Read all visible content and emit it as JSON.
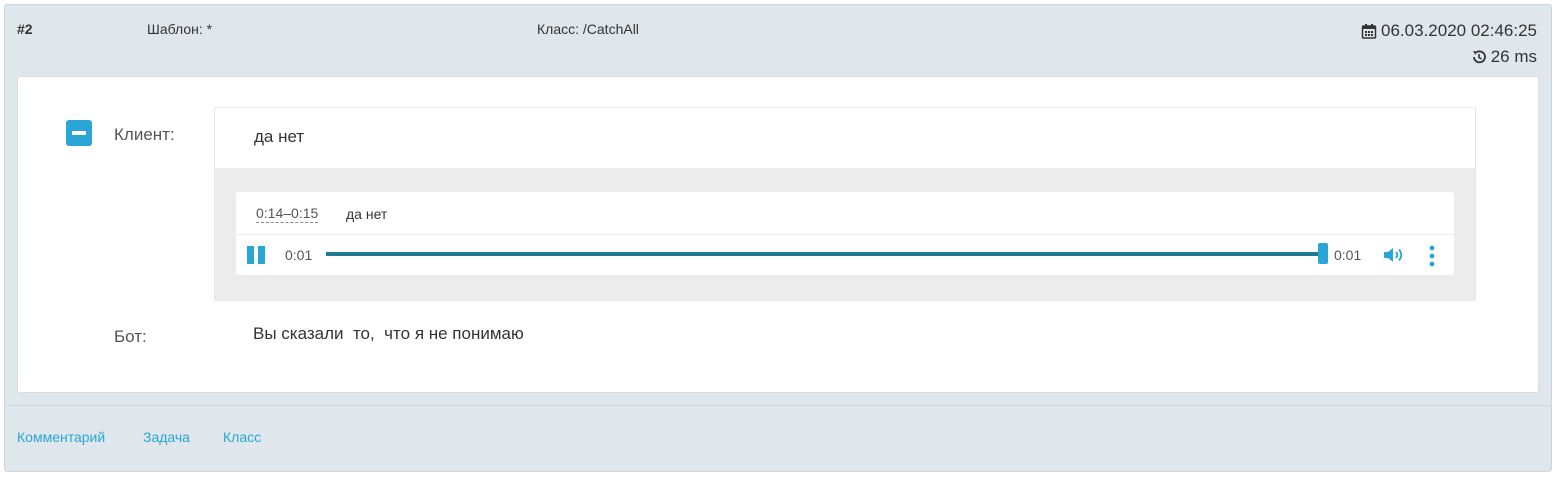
{
  "header": {
    "number": "#2",
    "template": "Шаблон: *",
    "class": "Класс: /CatchAll",
    "datetime": "06.03.2020 02:46:25",
    "duration": "26 ms",
    "icons": {
      "date": "calendar-icon",
      "duration": "history-icon"
    }
  },
  "dialog": {
    "client_label": "Клиент:",
    "client_text": "да нет",
    "bot_label": "Бот:",
    "bot_text": "Вы сказали  то,  что я не понимаю",
    "collapse_icon": "minus-square-icon"
  },
  "player": {
    "segment_time": "0:14–0:15",
    "segment_text": "да нет",
    "current_time": "0:01",
    "total_time": "0:01",
    "progress": 1.0,
    "state": "playing",
    "icons": {
      "play_pause": "pause-icon",
      "volume": "volume-icon",
      "more": "more-vertical-icon"
    }
  },
  "footer": {
    "links": [
      "Комментарий",
      "Задача",
      "Класс"
    ]
  },
  "colors": {
    "accent": "#2aa6d6",
    "progress_fill": "#1f7a96",
    "card_bg": "#dfe7ed",
    "grey_area": "#ececec"
  }
}
